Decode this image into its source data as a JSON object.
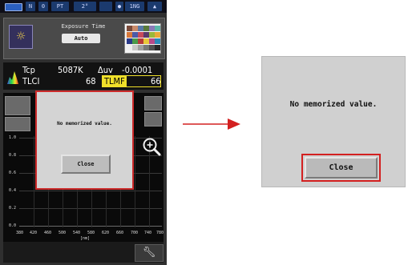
{
  "status_bar": {
    "items": [
      "N",
      "0",
      "PT",
      "2°",
      "",
      "1NG"
    ]
  },
  "exposure": {
    "label": "Exposure Time",
    "value": "Auto",
    "icon": "sun-icon"
  },
  "measurements": {
    "tcp_label": "Tcp",
    "tcp_value": "5087K",
    "duv_label": "Δuv",
    "duv_value": "-0.0001",
    "tlci_label": "TLCI",
    "tlci_value": "68",
    "tlmf_label": "TLMF",
    "tlmf_value": "66"
  },
  "graph": {
    "y_ticks": [
      "1.0",
      "0.8",
      "0.6",
      "0.4",
      "0.2",
      "0.0"
    ],
    "x_ticks": [
      "380",
      "420",
      "460",
      "500",
      "540",
      "580",
      "620",
      "660",
      "700",
      "740",
      "780"
    ],
    "x_unit": "[nm]"
  },
  "dialog": {
    "message": "No memorized value.",
    "close_label": "Close"
  },
  "zoomed_dialog": {
    "message": "No memorized value.",
    "close_label": "Close"
  },
  "colors": {
    "highlight_red": "#cc2a2a",
    "arrow_red": "#d32020",
    "tlmf_yellow": "#f0e02a"
  }
}
